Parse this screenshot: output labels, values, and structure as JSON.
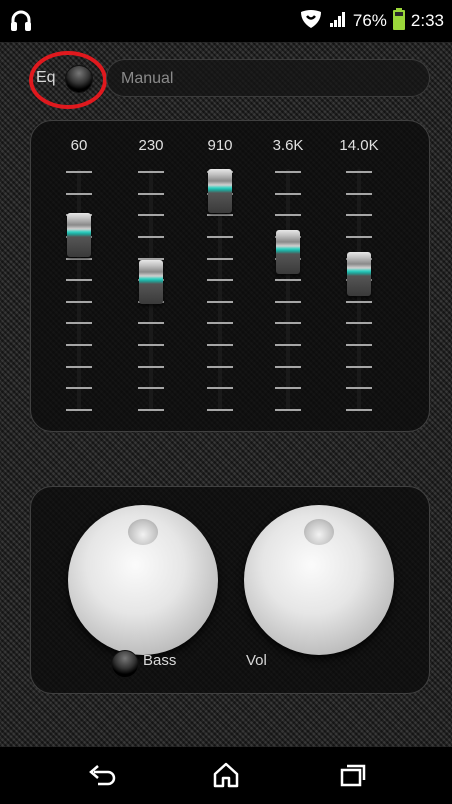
{
  "status_bar": {
    "battery": "76%",
    "time": "2:33",
    "icons": [
      "headphones-icon",
      "shield-icon",
      "signal-icon",
      "battery-icon"
    ]
  },
  "preset": {
    "eq_label": "Eq",
    "value": "Manual"
  },
  "equalizer": {
    "bands": [
      {
        "label": "60",
        "level": 0.78
      },
      {
        "label": "230",
        "level": 0.54
      },
      {
        "label": "910",
        "level": 1.0
      },
      {
        "label": "3.6K",
        "level": 0.69
      },
      {
        "label": "14.0K",
        "level": 0.58
      }
    ]
  },
  "knobs": {
    "bass_label": "Bass",
    "vol_label": "Vol"
  },
  "nav": {
    "icons": [
      "back-icon",
      "home-icon",
      "recent-apps-icon"
    ]
  },
  "colors": {
    "accent": "#1fa69a",
    "highlight": "#e0191e"
  }
}
